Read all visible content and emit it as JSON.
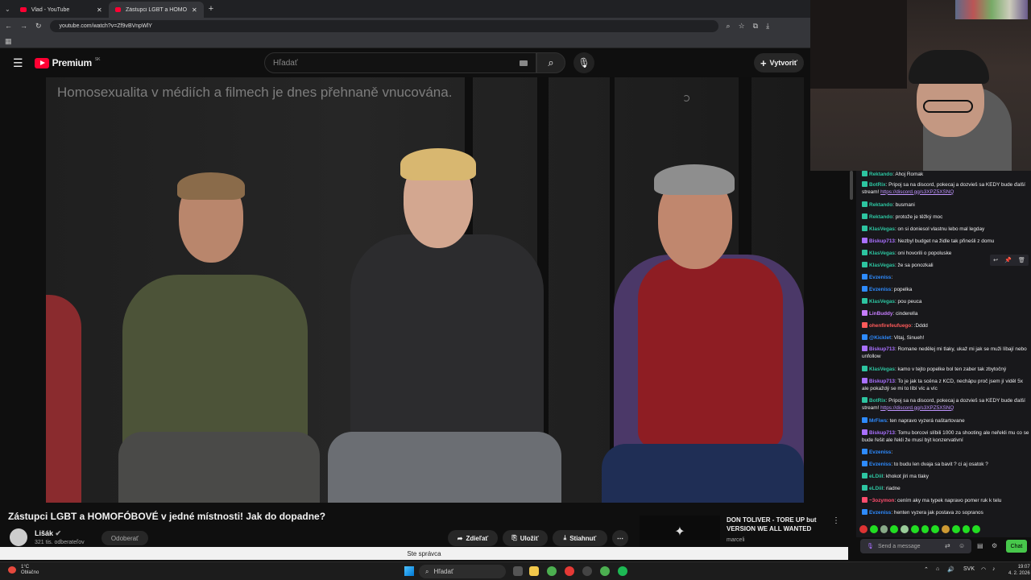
{
  "browser": {
    "tabs": [
      {
        "title": "Vlad - YouTube"
      },
      {
        "title": "Zástupci LGBT a HOMOFÓBOVÉ v"
      }
    ],
    "url": "youtube.com/watch?v=Zf9vBVnpWlY"
  },
  "youtube": {
    "logo_text": "Premium",
    "region": "SK",
    "search_placeholder": "Hľadať",
    "create_label": "Vytvoriť",
    "video_caption": "Homosexualita v médiích a filmech je dnes přehnaně vnucována.",
    "video_title": "Zástupci LGBT a HOMOFÓBOVÉ v jedné místnosti! Jak do dopadne?",
    "channel_name": "Lišák",
    "subscribers": "321 tis. odberateľov",
    "unsubscribe_label": "Odoberať",
    "share_label": "Zdieľať",
    "save_label": "Uložiť",
    "download_label": "Stiahnuť",
    "recommended": {
      "title": "DON TOLIVER - TORE UP but VERSION WE ALL WANTED",
      "author": "marceli"
    },
    "manager_banner": "Ste správca"
  },
  "chat": {
    "messages": [
      {
        "user": "Rektando",
        "text": "Ahoj Romak",
        "color": "#2dc5a1"
      },
      {
        "user": "BotRix",
        "text": "Pripoj sa na discord, pokecaj a dozvieš sa KEDY bude ďalší stream!",
        "link": "https://discord.gg/s3XPZ5XSNQ",
        "color": "#2dc5a1"
      },
      {
        "user": "Rektando",
        "text": "busmani",
        "color": "#2dc5a1"
      },
      {
        "user": "Rektando",
        "text": "protože je těžký moc",
        "color": "#2dc5a1"
      },
      {
        "user": "KlasVegas",
        "text": "on si doniesol vlastnu lebo mal legday",
        "color": "#2dc5a1"
      },
      {
        "user": "Biskup713",
        "text": "Nezbyl budget na židle tak přineśli z domu",
        "color": "#a970ff"
      },
      {
        "user": "KlasVegas",
        "text": "oni hovorili o popoluske",
        "color": "#2dc5a1"
      },
      {
        "user": "KlasVegas",
        "text": "že sa ponozkali",
        "color": "#2dc5a1"
      },
      {
        "user": "Evzeniss",
        "text": "",
        "color": "#2e8bff"
      },
      {
        "user": "Evzeniss",
        "text": "popelka",
        "color": "#2e8bff"
      },
      {
        "user": "KlasVegas",
        "text": "pou peuca",
        "color": "#2dc5a1"
      },
      {
        "user": "LinBuddy",
        "text": "cinderella",
        "color": "#c77dff"
      },
      {
        "user": "ohenfirefeufuego",
        "text": ":Dddd",
        "color": "#ff5a5a"
      },
      {
        "user": "@Kicklet",
        "text": "Vitaj, Sinueh!",
        "color": "#2e8bff"
      },
      {
        "user": "Biskup713",
        "text": "Romane nedělej mi tlaky, ukaž mi jak se muži líbají nebo unfollow",
        "color": "#a970ff"
      },
      {
        "user": "KlasVegas",
        "text": "kamo v tejto popelke bol ten zaber tak zbytočný",
        "color": "#2dc5a1"
      },
      {
        "user": "Biskup713",
        "text": "To je jak ta scéna z KCD, nechápu proč jsem jí viděl 5x ale pokaždý se mi to líbí víc a víc",
        "color": "#a970ff"
      },
      {
        "user": "BotRix",
        "text": "Pripoj sa na discord, pokecaj a dozvieš sa KEDY bude ďalší stream!",
        "link": "https://discord.gg/s3XPZ5XSNQ",
        "color": "#2dc5a1"
      },
      {
        "user": "MrFiws",
        "text": "ten napravo vyzerá naštartovane",
        "color": "#2e8bff"
      },
      {
        "user": "Biskup713",
        "text": "Tomu borcovi slíbili 1000 za shooting ale neřekli mu co se bude řešit ale řekli že musí být konzervativní",
        "color": "#a970ff"
      },
      {
        "user": "Evzeniss",
        "text": "",
        "color": "#2e8bff"
      },
      {
        "user": "Evzeniss",
        "text": "to budu len dvaja sa bavit ? ci aj osatok ?",
        "color": "#2e8bff"
      },
      {
        "user": "eLDiil",
        "text": "khokot jíri ma tlaky",
        "color": "#2dc5a1"
      },
      {
        "user": "eLDiil",
        "text": "riadne",
        "color": "#2dc5a1"
      },
      {
        "user": "~3ozymon",
        "text": "cením aky ma typek napravo pomer ruk k telu",
        "color": "#ff4d6d"
      },
      {
        "user": "Evzeniss",
        "text": "henten vyzera jak postava zo sopranos",
        "color": "#2e8bff"
      }
    ],
    "input_placeholder": "Send a message",
    "send_label": "Chat"
  },
  "taskbar": {
    "temperature": "1°C",
    "weather": "Oblačno",
    "search_label": "Hľadať",
    "language": "SVK",
    "time": "19:07",
    "date": "4. 2. 2026"
  },
  "colors": {
    "youtube_red": "#ff0033",
    "chat_bg": "#18181b",
    "chat_send": "#47c74b"
  }
}
